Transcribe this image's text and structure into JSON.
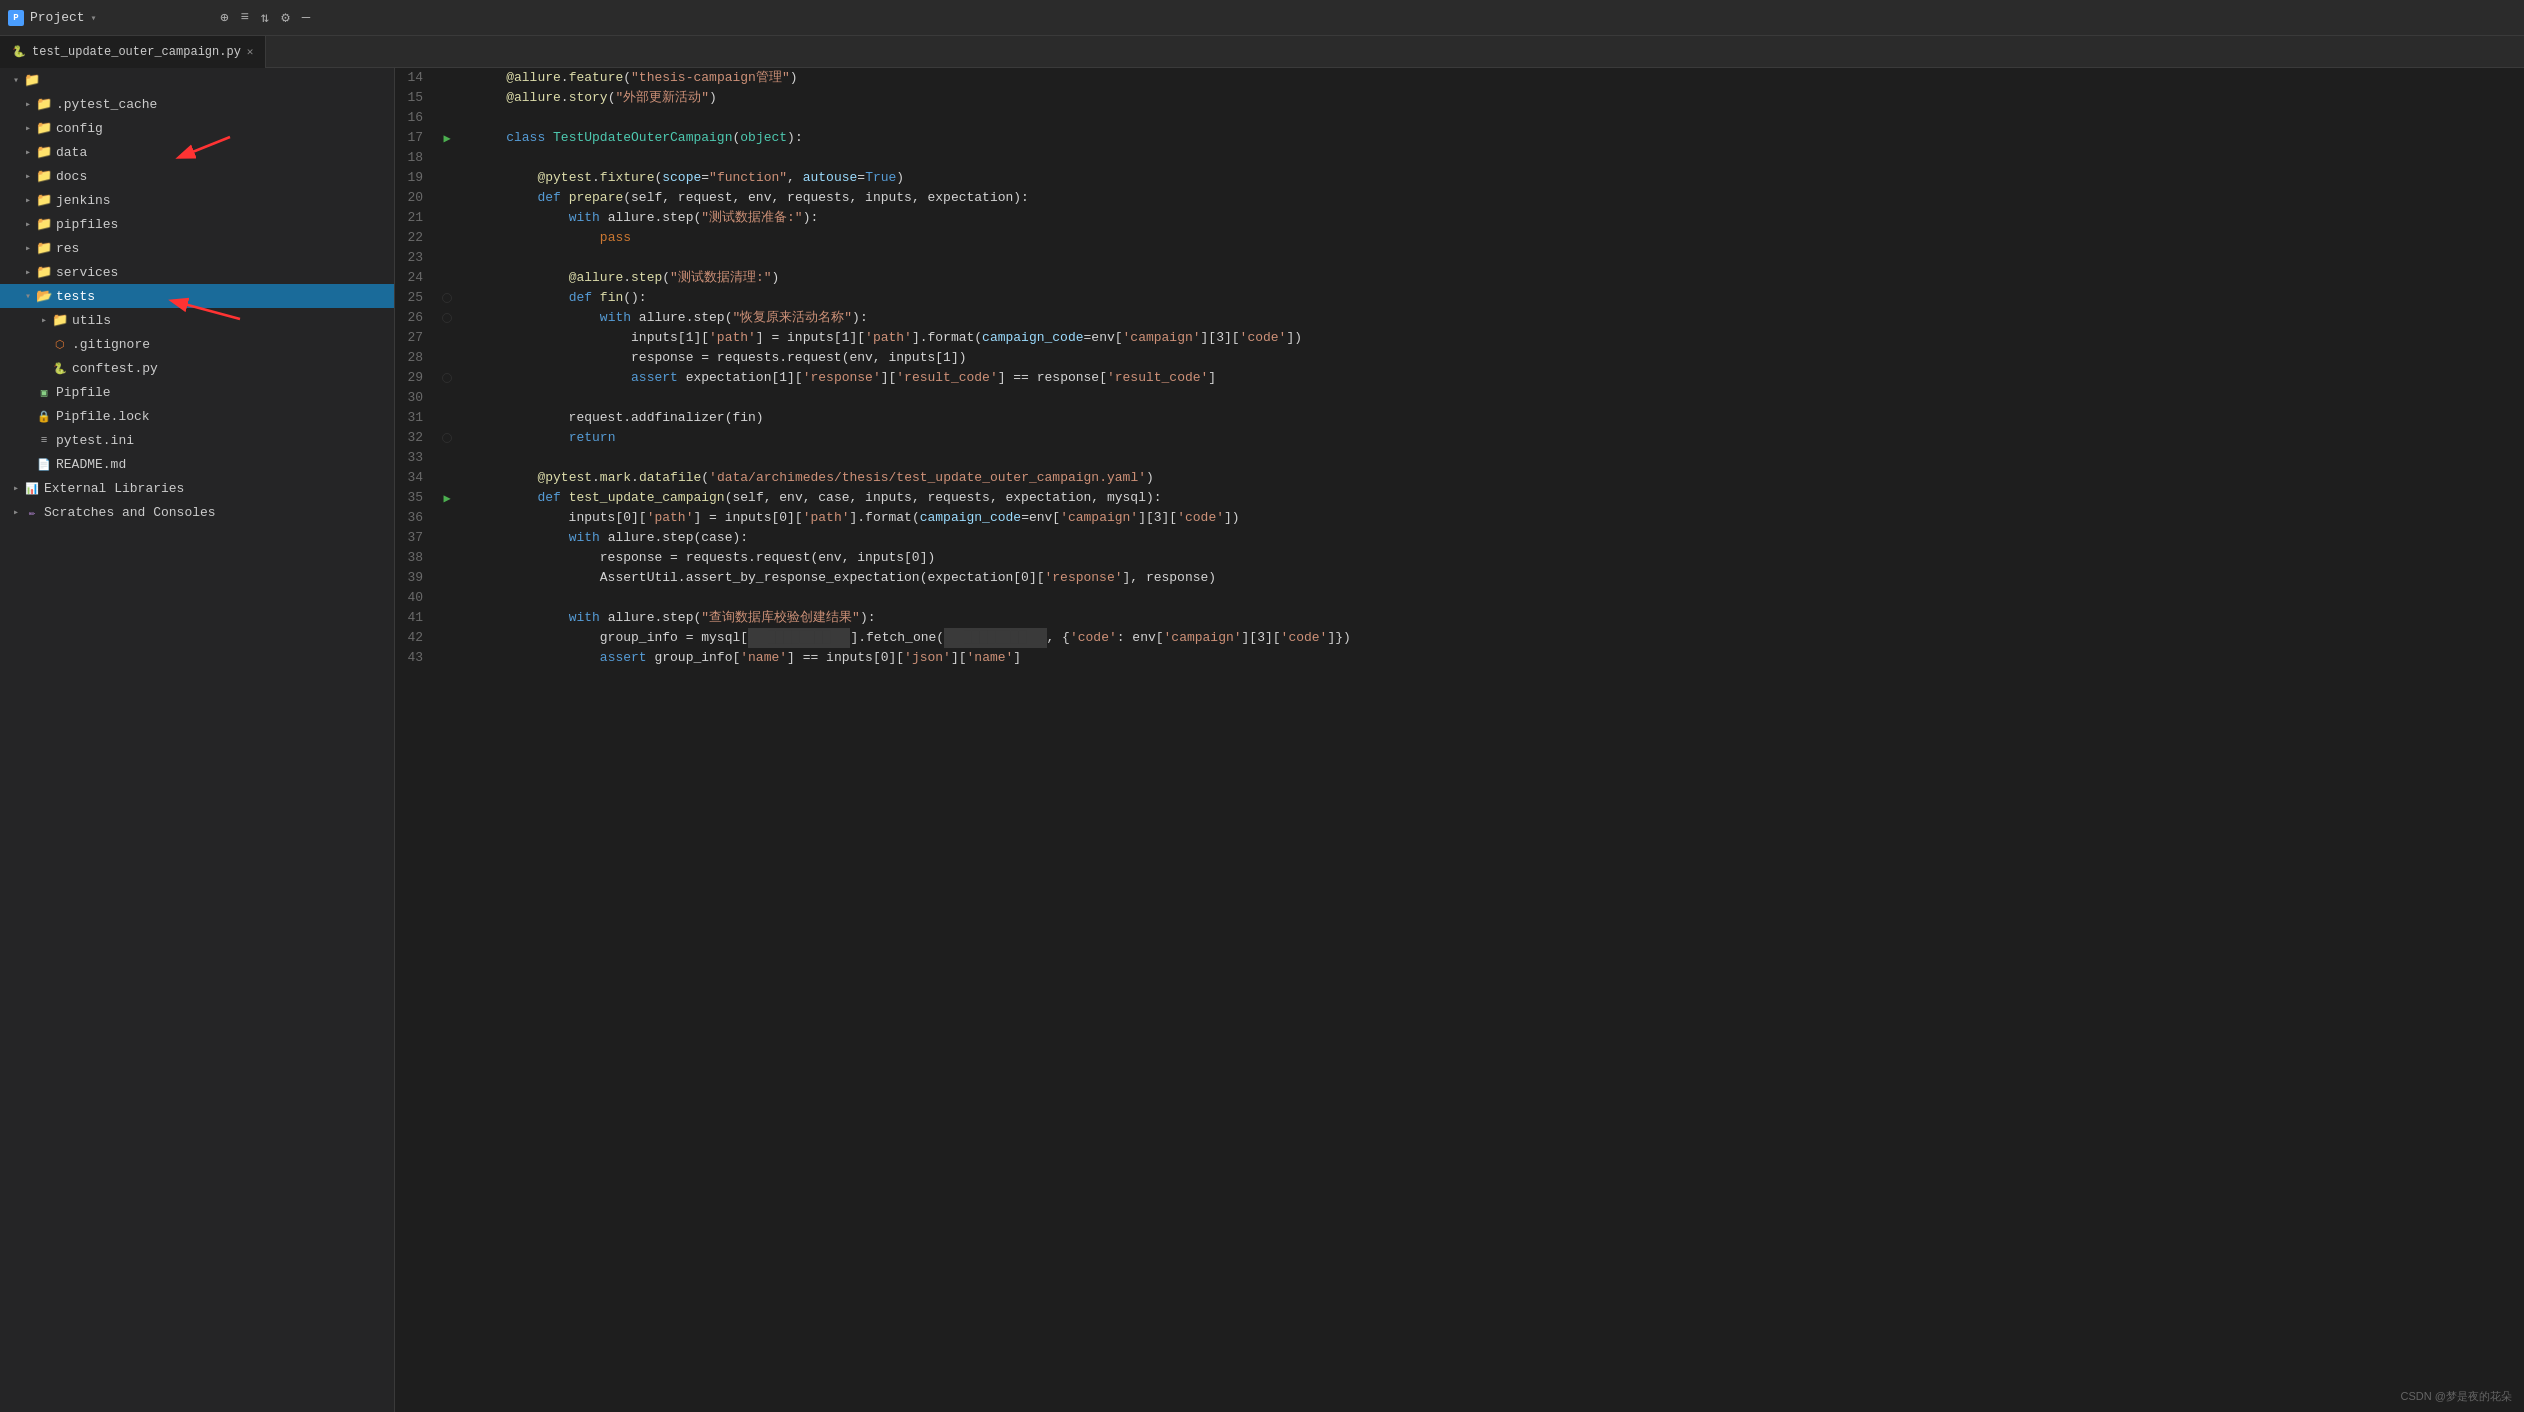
{
  "titlebar": {
    "project_label": "Project",
    "arrow": "▾",
    "tab_filename": "test_update_outer_campaign.py",
    "icons": [
      "⊕",
      "≡",
      "⇅",
      "⚙",
      "—"
    ]
  },
  "sidebar": {
    "items": [
      {
        "id": "root",
        "label": "",
        "indent": 0,
        "type": "folder",
        "open": true
      },
      {
        "id": "pytest_cache",
        "label": ".pytest_cache",
        "indent": 1,
        "type": "folder",
        "open": false
      },
      {
        "id": "config",
        "label": "config",
        "indent": 1,
        "type": "folder",
        "open": false
      },
      {
        "id": "data",
        "label": "data",
        "indent": 1,
        "type": "folder",
        "open": false
      },
      {
        "id": "docs",
        "label": "docs",
        "indent": 1,
        "type": "folder",
        "open": false
      },
      {
        "id": "jenkins",
        "label": "jenkins",
        "indent": 1,
        "type": "folder",
        "open": false
      },
      {
        "id": "pipfiles",
        "label": "pipfiles",
        "indent": 1,
        "type": "folder",
        "open": false
      },
      {
        "id": "res",
        "label": "res",
        "indent": 1,
        "type": "folder",
        "open": false
      },
      {
        "id": "services",
        "label": "services",
        "indent": 1,
        "type": "folder",
        "open": false
      },
      {
        "id": "tests",
        "label": "tests",
        "indent": 1,
        "type": "folder",
        "open": true,
        "selected": true
      },
      {
        "id": "utils",
        "label": "utils",
        "indent": 2,
        "type": "folder",
        "open": false
      },
      {
        "id": "gitignore",
        "label": ".gitignore",
        "indent": 2,
        "type": "file-git"
      },
      {
        "id": "conftest",
        "label": "conftest.py",
        "indent": 2,
        "type": "file-py"
      },
      {
        "id": "pipfile",
        "label": "Pipfile",
        "indent": 1,
        "type": "file-pipe"
      },
      {
        "id": "pipfile_lock",
        "label": "Pipfile.lock",
        "indent": 1,
        "type": "file-lock"
      },
      {
        "id": "pytest_ini",
        "label": "pytest.ini",
        "indent": 1,
        "type": "file-ini"
      },
      {
        "id": "readme",
        "label": "README.md",
        "indent": 1,
        "type": "file-md"
      },
      {
        "id": "external_libs",
        "label": "External Libraries",
        "indent": 0,
        "type": "ext-lib"
      },
      {
        "id": "scratches",
        "label": "Scratches and Consoles",
        "indent": 0,
        "type": "scratches"
      }
    ]
  },
  "code": {
    "lines": [
      {
        "num": 14,
        "content": "    @allure.feature(\"thesis-campaign管理\")"
      },
      {
        "num": 15,
        "content": "    @allure.story(\"外部更新活动\")"
      },
      {
        "num": 16,
        "content": ""
      },
      {
        "num": 17,
        "content": "    class TestUpdateOuterCampaign(object):",
        "run": true
      },
      {
        "num": 18,
        "content": ""
      },
      {
        "num": 19,
        "content": "        @pytest.fixture(scope=\"function\", autouse=True)"
      },
      {
        "num": 20,
        "content": "        def prepare(self, request, env, requests, inputs, expectation):"
      },
      {
        "num": 21,
        "content": "            with allure.step(\"测试数据准备:\"):"
      },
      {
        "num": 22,
        "content": "                pass"
      },
      {
        "num": 23,
        "content": ""
      },
      {
        "num": 24,
        "content": "            @allure.step(\"测试数据清理:\")"
      },
      {
        "num": 25,
        "content": "            def fin():",
        "breakpoint": true
      },
      {
        "num": 26,
        "content": "                with allure.step(\"恢复原来活动名称\"):",
        "breakpoint": true
      },
      {
        "num": 27,
        "content": "                    inputs[1]['path'] = inputs[1]['path'].format(campaign_code=env['campaign'][3]['code'])"
      },
      {
        "num": 28,
        "content": "                    response = requests.request(env, inputs[1])"
      },
      {
        "num": 29,
        "content": "                    assert expectation[1]['response']['result_code'] == response['result_code']",
        "breakpoint": true
      },
      {
        "num": 30,
        "content": ""
      },
      {
        "num": 31,
        "content": "            request.addfinalizer(fin)"
      },
      {
        "num": 32,
        "content": "            return",
        "breakpoint": true
      },
      {
        "num": 33,
        "content": ""
      },
      {
        "num": 34,
        "content": "        @pytest.mark.datafile('data/archimedes/thesis/test_update_outer_campaign.yaml')"
      },
      {
        "num": 35,
        "content": "        def test_update_campaign(self, env, case, inputs, requests, expectation, mysql):",
        "run": true
      },
      {
        "num": 36,
        "content": "            inputs[0]['path'] = inputs[0]['path'].format(campaign_code=env['campaign'][3]['code'])"
      },
      {
        "num": 37,
        "content": "            with allure.step(case):"
      },
      {
        "num": 38,
        "content": "                response = requests.request(env, inputs[0])"
      },
      {
        "num": 39,
        "content": "                AssertUtil.assert_by_response_expectation(expectation[0]['response'], response)"
      },
      {
        "num": 40,
        "content": ""
      },
      {
        "num": 41,
        "content": "            with allure.step(\"查询数据库校验创建结果\"):"
      },
      {
        "num": 42,
        "content": "                group_info = mysql[█████████].fetch_one(█████████, {'code': env['campaign'][3]['code']})"
      },
      {
        "num": 43,
        "content": "                assert group_info['name'] == inputs[0]['json']['name']"
      }
    ]
  },
  "watermark": "CSDN @梦是夜的花朵"
}
